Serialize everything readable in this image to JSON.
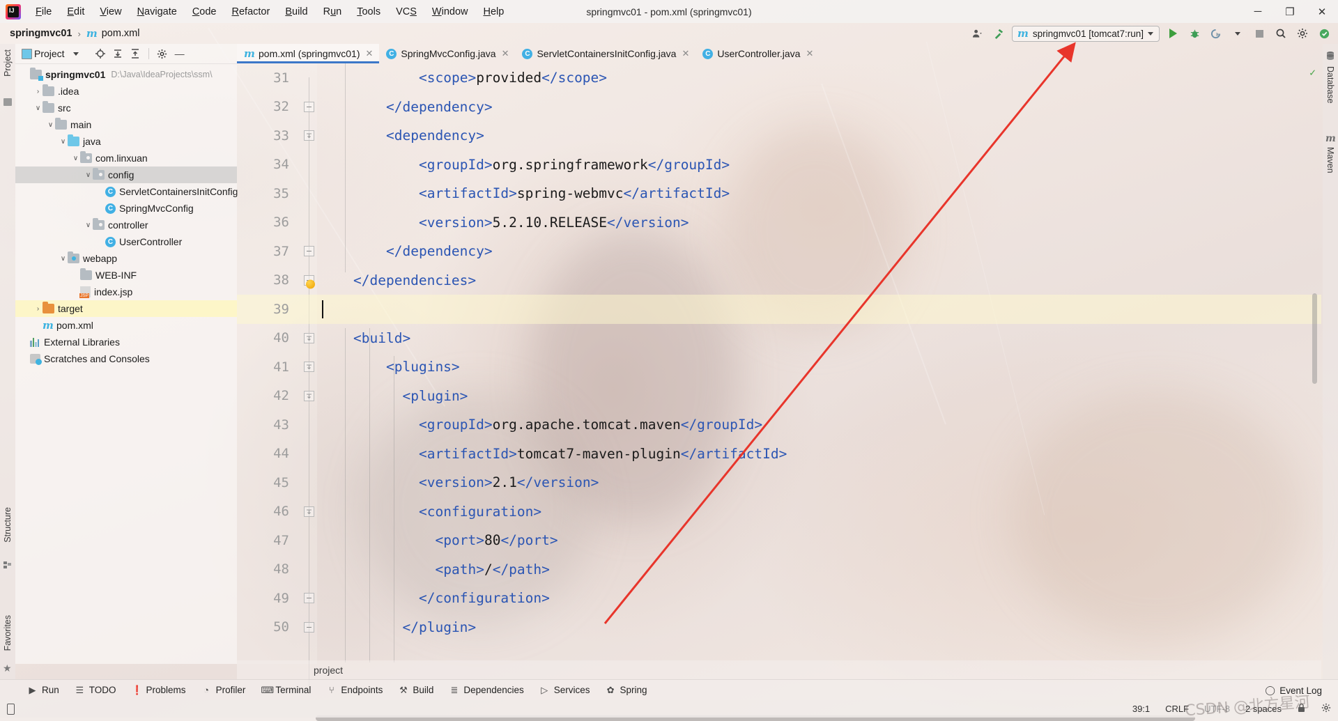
{
  "window": {
    "title": "springmvc01 - pom.xml (springmvc01)",
    "minimize": "─",
    "maximize": "❐",
    "close": "✕"
  },
  "menubar": {
    "items": [
      {
        "label": "File",
        "mnemonic": "F"
      },
      {
        "label": "Edit",
        "mnemonic": "E"
      },
      {
        "label": "View",
        "mnemonic": "V"
      },
      {
        "label": "Navigate",
        "mnemonic": "N"
      },
      {
        "label": "Code",
        "mnemonic": "C"
      },
      {
        "label": "Refactor",
        "mnemonic": "R"
      },
      {
        "label": "Build",
        "mnemonic": "B"
      },
      {
        "label": "Run",
        "mnemonic": "u"
      },
      {
        "label": "Tools",
        "mnemonic": "T"
      },
      {
        "label": "VCS",
        "mnemonic": "S"
      },
      {
        "label": "Window",
        "mnemonic": "W"
      },
      {
        "label": "Help",
        "mnemonic": "H"
      }
    ]
  },
  "navbar": {
    "project": "springmvc01",
    "separator": "›",
    "file": "pom.xml",
    "maven_icon": "m",
    "run_config": {
      "icon": "m",
      "label": "springmvc01 [tomcat7:run]"
    },
    "icons": [
      "user-settings-icon",
      "build-hammer-icon",
      "run-icon",
      "debug-icon",
      "run-with-coverage-icon",
      "dropdown-icon",
      "stop-icon",
      "search-icon",
      "settings-icon",
      "updates-icon"
    ]
  },
  "left_stripe": {
    "project_label": "Project",
    "structure_label": "Structure",
    "favorites_label": "Favorites"
  },
  "right_stripe": {
    "database_label": "Database",
    "maven_label": "Maven"
  },
  "project_panel": {
    "title": "Project",
    "toolbar_icons": [
      "locate-icon",
      "expand-all-icon",
      "collapse-all-icon",
      "settings-icon",
      "hide-icon"
    ],
    "tree": [
      {
        "depth": 0,
        "arrow": "",
        "icon": "module-folder",
        "label": "springmvc01",
        "bold": true,
        "path": "D:\\Java\\IdeaProjects\\ssm\\",
        "state": "normal"
      },
      {
        "depth": 1,
        "arrow": "›",
        "icon": "folder",
        "label": ".idea",
        "bold": false,
        "path": "",
        "state": "normal"
      },
      {
        "depth": 1,
        "arrow": "∨",
        "icon": "folder",
        "label": "src",
        "bold": false,
        "path": "",
        "state": "normal"
      },
      {
        "depth": 2,
        "arrow": "∨",
        "icon": "folder",
        "label": "main",
        "bold": false,
        "path": "",
        "state": "normal"
      },
      {
        "depth": 3,
        "arrow": "∨",
        "icon": "source-folder",
        "label": "java",
        "bold": false,
        "path": "",
        "state": "normal"
      },
      {
        "depth": 4,
        "arrow": "∨",
        "icon": "package",
        "label": "com.linxuan",
        "bold": false,
        "path": "",
        "state": "normal"
      },
      {
        "depth": 5,
        "arrow": "∨",
        "icon": "package",
        "label": "config",
        "bold": false,
        "path": "",
        "state": "selected"
      },
      {
        "depth": 6,
        "arrow": "",
        "icon": "java-class",
        "label": "ServletContainersInitConfig",
        "bold": false,
        "path": "",
        "state": "normal"
      },
      {
        "depth": 6,
        "arrow": "",
        "icon": "java-class",
        "label": "SpringMvcConfig",
        "bold": false,
        "path": "",
        "state": "normal"
      },
      {
        "depth": 5,
        "arrow": "∨",
        "icon": "package",
        "label": "controller",
        "bold": false,
        "path": "",
        "state": "normal"
      },
      {
        "depth": 6,
        "arrow": "",
        "icon": "java-class",
        "label": "UserController",
        "bold": false,
        "path": "",
        "state": "normal"
      },
      {
        "depth": 3,
        "arrow": "∨",
        "icon": "web-resource-folder",
        "label": "webapp",
        "bold": false,
        "path": "",
        "state": "normal"
      },
      {
        "depth": 4,
        "arrow": "",
        "icon": "folder",
        "label": "WEB-INF",
        "bold": false,
        "path": "",
        "state": "normal"
      },
      {
        "depth": 4,
        "arrow": "",
        "icon": "jsp-file",
        "label": "index.jsp",
        "bold": false,
        "path": "",
        "state": "normal"
      },
      {
        "depth": 1,
        "arrow": "›",
        "icon": "excluded-folder",
        "label": "target",
        "bold": false,
        "path": "",
        "state": "highlight"
      },
      {
        "depth": 1,
        "arrow": "",
        "icon": "maven-file",
        "label": "pom.xml",
        "bold": false,
        "path": "",
        "state": "normal"
      },
      {
        "depth": 0,
        "arrow": "",
        "icon": "libraries",
        "label": "External Libraries",
        "bold": false,
        "path": "",
        "state": "normal"
      },
      {
        "depth": 0,
        "arrow": "",
        "icon": "scratches",
        "label": "Scratches and Consoles",
        "bold": false,
        "path": "",
        "state": "normal"
      }
    ]
  },
  "editor_tabs": [
    {
      "icon": "maven-file",
      "label": "pom.xml (springmvc01)",
      "active": true
    },
    {
      "icon": "java-class",
      "label": "SpringMvcConfig.java",
      "active": false
    },
    {
      "icon": "java-class",
      "label": "ServletContainersInitConfig.java",
      "active": false
    },
    {
      "icon": "java-class",
      "label": "UserController.java",
      "active": false
    }
  ],
  "editor": {
    "first_line": 31,
    "current_line": 39,
    "breadcrumb": "project",
    "lines": [
      {
        "num": 31,
        "fold": "",
        "indent": 6,
        "segments": [
          {
            "t": "tag",
            "v": "<scope>"
          },
          {
            "t": "txt",
            "v": "provided"
          },
          {
            "t": "tag",
            "v": "</scope>"
          }
        ]
      },
      {
        "num": 32,
        "fold": "end",
        "indent": 4,
        "segments": [
          {
            "t": "tag",
            "v": "</dependency>"
          }
        ]
      },
      {
        "num": 33,
        "fold": "start",
        "indent": 4,
        "segments": [
          {
            "t": "tag",
            "v": "<dependency>"
          }
        ]
      },
      {
        "num": 34,
        "fold": "",
        "indent": 6,
        "segments": [
          {
            "t": "tag",
            "v": "<groupId>"
          },
          {
            "t": "txt",
            "v": "org.springframework"
          },
          {
            "t": "tag",
            "v": "</groupId>"
          }
        ]
      },
      {
        "num": 35,
        "fold": "",
        "indent": 6,
        "segments": [
          {
            "t": "tag",
            "v": "<artifactId>"
          },
          {
            "t": "txt",
            "v": "spring-webmvc"
          },
          {
            "t": "tag",
            "v": "</artifactId>"
          }
        ]
      },
      {
        "num": 36,
        "fold": "",
        "indent": 6,
        "segments": [
          {
            "t": "tag",
            "v": "<version>"
          },
          {
            "t": "txt",
            "v": "5.2.10.RELEASE"
          },
          {
            "t": "tag",
            "v": "</version>"
          }
        ]
      },
      {
        "num": 37,
        "fold": "end",
        "indent": 4,
        "segments": [
          {
            "t": "tag",
            "v": "</dependency>"
          }
        ]
      },
      {
        "num": 38,
        "fold": "end",
        "indent": 2,
        "segments": [
          {
            "t": "tag",
            "v": "</dependencies>"
          }
        ],
        "bulb": true
      },
      {
        "num": 39,
        "fold": "",
        "indent": 2,
        "segments": [],
        "current": true,
        "caret": true
      },
      {
        "num": 40,
        "fold": "start",
        "indent": 2,
        "segments": [
          {
            "t": "tag",
            "v": "<build>"
          }
        ]
      },
      {
        "num": 41,
        "fold": "start",
        "indent": 4,
        "segments": [
          {
            "t": "tag",
            "v": "<plugins>"
          }
        ]
      },
      {
        "num": 42,
        "fold": "start",
        "indent": 5,
        "segments": [
          {
            "t": "tag",
            "v": "<plugin>"
          }
        ]
      },
      {
        "num": 43,
        "fold": "",
        "indent": 6,
        "segments": [
          {
            "t": "tag",
            "v": "<groupId>"
          },
          {
            "t": "txt",
            "v": "org.apache.tomcat.maven"
          },
          {
            "t": "tag",
            "v": "</groupId>"
          }
        ]
      },
      {
        "num": 44,
        "fold": "",
        "indent": 6,
        "segments": [
          {
            "t": "tag",
            "v": "<artifactId>"
          },
          {
            "t": "txt",
            "v": "tomcat7-maven-plugin"
          },
          {
            "t": "tag",
            "v": "</artifactId>"
          }
        ]
      },
      {
        "num": 45,
        "fold": "",
        "indent": 6,
        "segments": [
          {
            "t": "tag",
            "v": "<version>"
          },
          {
            "t": "txt",
            "v": "2.1"
          },
          {
            "t": "tag",
            "v": "</version>"
          }
        ]
      },
      {
        "num": 46,
        "fold": "start",
        "indent": 6,
        "segments": [
          {
            "t": "tag",
            "v": "<configuration>"
          }
        ]
      },
      {
        "num": 47,
        "fold": "",
        "indent": 7,
        "segments": [
          {
            "t": "tag",
            "v": "<port>"
          },
          {
            "t": "txt",
            "v": "80"
          },
          {
            "t": "tag",
            "v": "</port>"
          }
        ]
      },
      {
        "num": 48,
        "fold": "",
        "indent": 7,
        "segments": [
          {
            "t": "tag",
            "v": "<path>"
          },
          {
            "t": "txt",
            "v": "/"
          },
          {
            "t": "tag",
            "v": "</path>"
          }
        ]
      },
      {
        "num": 49,
        "fold": "end",
        "indent": 6,
        "segments": [
          {
            "t": "tag",
            "v": "</configuration>"
          }
        ]
      },
      {
        "num": 50,
        "fold": "end",
        "indent": 5,
        "segments": [
          {
            "t": "tag",
            "v": "</plugin>"
          }
        ]
      }
    ]
  },
  "bottom_bar": {
    "items": [
      {
        "icon": "▶",
        "label": "Run"
      },
      {
        "icon": "☰",
        "label": "TODO"
      },
      {
        "icon": "❗",
        "label": "Problems"
      },
      {
        "icon": "◔",
        "label": "Profiler"
      },
      {
        "icon": "⌨",
        "label": "Terminal"
      },
      {
        "icon": "⑂",
        "label": "Endpoints"
      },
      {
        "icon": "⚒",
        "label": "Build"
      },
      {
        "icon": "≣",
        "label": "Dependencies"
      },
      {
        "icon": "▷",
        "label": "Services"
      },
      {
        "icon": "✿",
        "label": "Spring"
      }
    ],
    "event_log": "Event Log",
    "event_log_icon": "bell-icon"
  },
  "status_bar": {
    "caret_position": "39:1",
    "line_separator": "CRLF",
    "encoding": "UTF-8",
    "indent": "2 spaces",
    "lock_icon": "lock-icon",
    "settings_icon": "settings-icon"
  },
  "annotation": {
    "arrow_color": "#e8352b"
  },
  "watermark": "CSDN @北方星河"
}
